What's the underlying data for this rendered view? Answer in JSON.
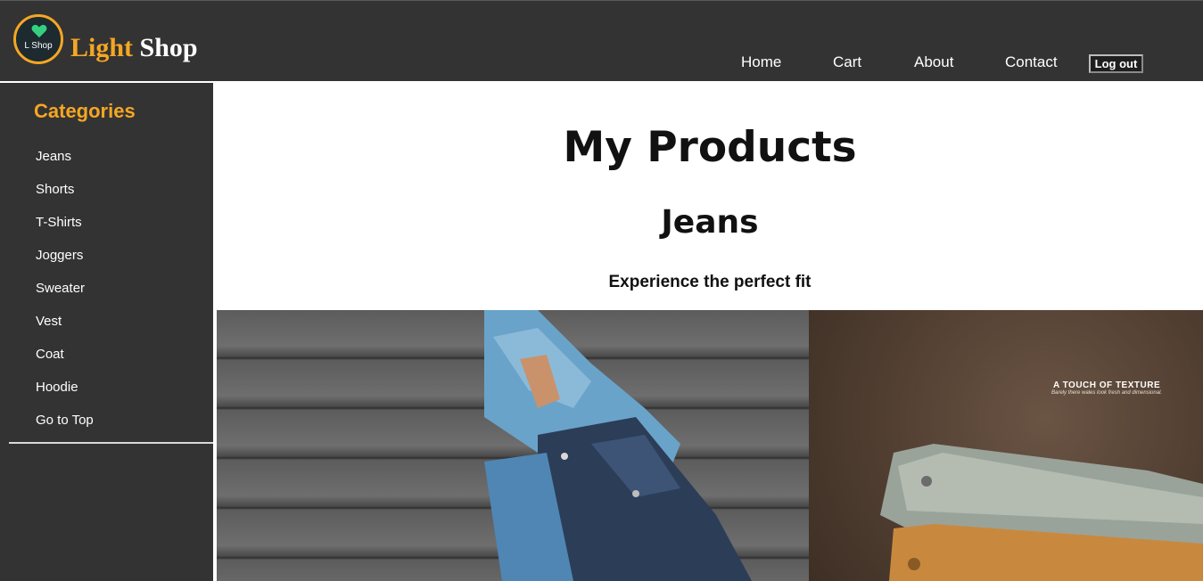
{
  "header": {
    "logo_text": "L Shop",
    "brand_light": "Light",
    "brand_shop": "Shop",
    "nav": [
      {
        "label": "Home"
      },
      {
        "label": "Cart"
      },
      {
        "label": "About"
      },
      {
        "label": "Contact"
      }
    ],
    "logout_label": "Log out"
  },
  "sidebar": {
    "title": "Categories",
    "items": [
      {
        "label": "Jeans"
      },
      {
        "label": "Shorts"
      },
      {
        "label": "T-Shirts"
      },
      {
        "label": "Joggers"
      },
      {
        "label": "Sweater"
      },
      {
        "label": "Vest"
      },
      {
        "label": "Coat"
      },
      {
        "label": "Hoodie"
      },
      {
        "label": "Go to Top"
      }
    ]
  },
  "main": {
    "title": "My Products",
    "section_title": "Jeans",
    "section_subtitle": "Experience the perfect fit",
    "banner_right": {
      "headline": "A TOUCH OF TEXTURE",
      "tagline": "Barely there wales look fresh and dimensional."
    }
  },
  "colors": {
    "accent": "#f5a623",
    "header_bg": "#333333",
    "sidebar_bg": "#333333"
  }
}
